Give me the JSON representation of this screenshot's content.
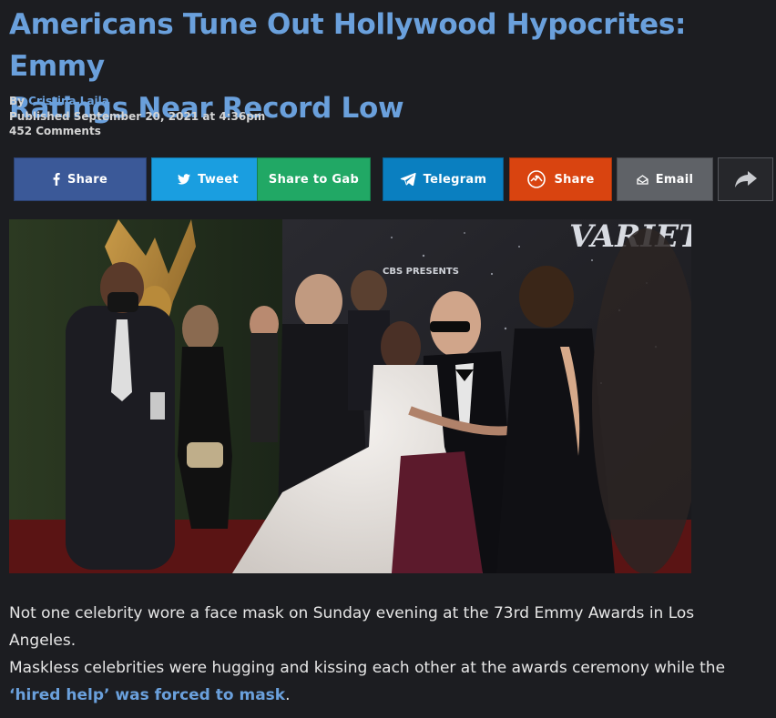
{
  "article": {
    "headline_line1": "Americans Tune Out Hollywood Hypocrites: Emmy",
    "headline_line2": "Ratings Near Record Low",
    "by_prefix": "By ",
    "author": "Cristina Laila",
    "published": "Published September 20, 2021 at 4:36pm",
    "comments": "452 Comments",
    "paragraph1": "Not one celebrity wore a face mask on Sunday evening at the 73rd Emmy Awards in Los Angeles.",
    "paragraph2_text": "Maskless celebrities were hugging and kissing each other at the awards ceremony while the ",
    "paragraph2_link": "‘hired help’ was forced to mask",
    "paragraph2_end": "."
  },
  "share": {
    "facebook": {
      "label": "Share",
      "icon": "facebook-icon",
      "color": "#3b5998"
    },
    "twitter": {
      "label": "Tweet",
      "icon": "twitter-bird-icon",
      "color": "#1da1f2"
    },
    "gab": {
      "label": "Share to Gab",
      "color": "#21b36a"
    },
    "telegram": {
      "label": "Telegram",
      "icon": "telegram-plane-icon",
      "color": "#0a89c9"
    },
    "gettr": {
      "label": "Share",
      "icon": "gettr-icon",
      "color": "#e0470f"
    },
    "email": {
      "label": "Email",
      "icon": "envelope-icon",
      "color": "#6a6d72"
    },
    "more": {
      "icon": "forward-arrow-icon",
      "color": "#2a2b30"
    }
  },
  "hero_image": {
    "overlay_logo": "VARIETY",
    "backdrop_text": "CBS PRESENTS"
  }
}
